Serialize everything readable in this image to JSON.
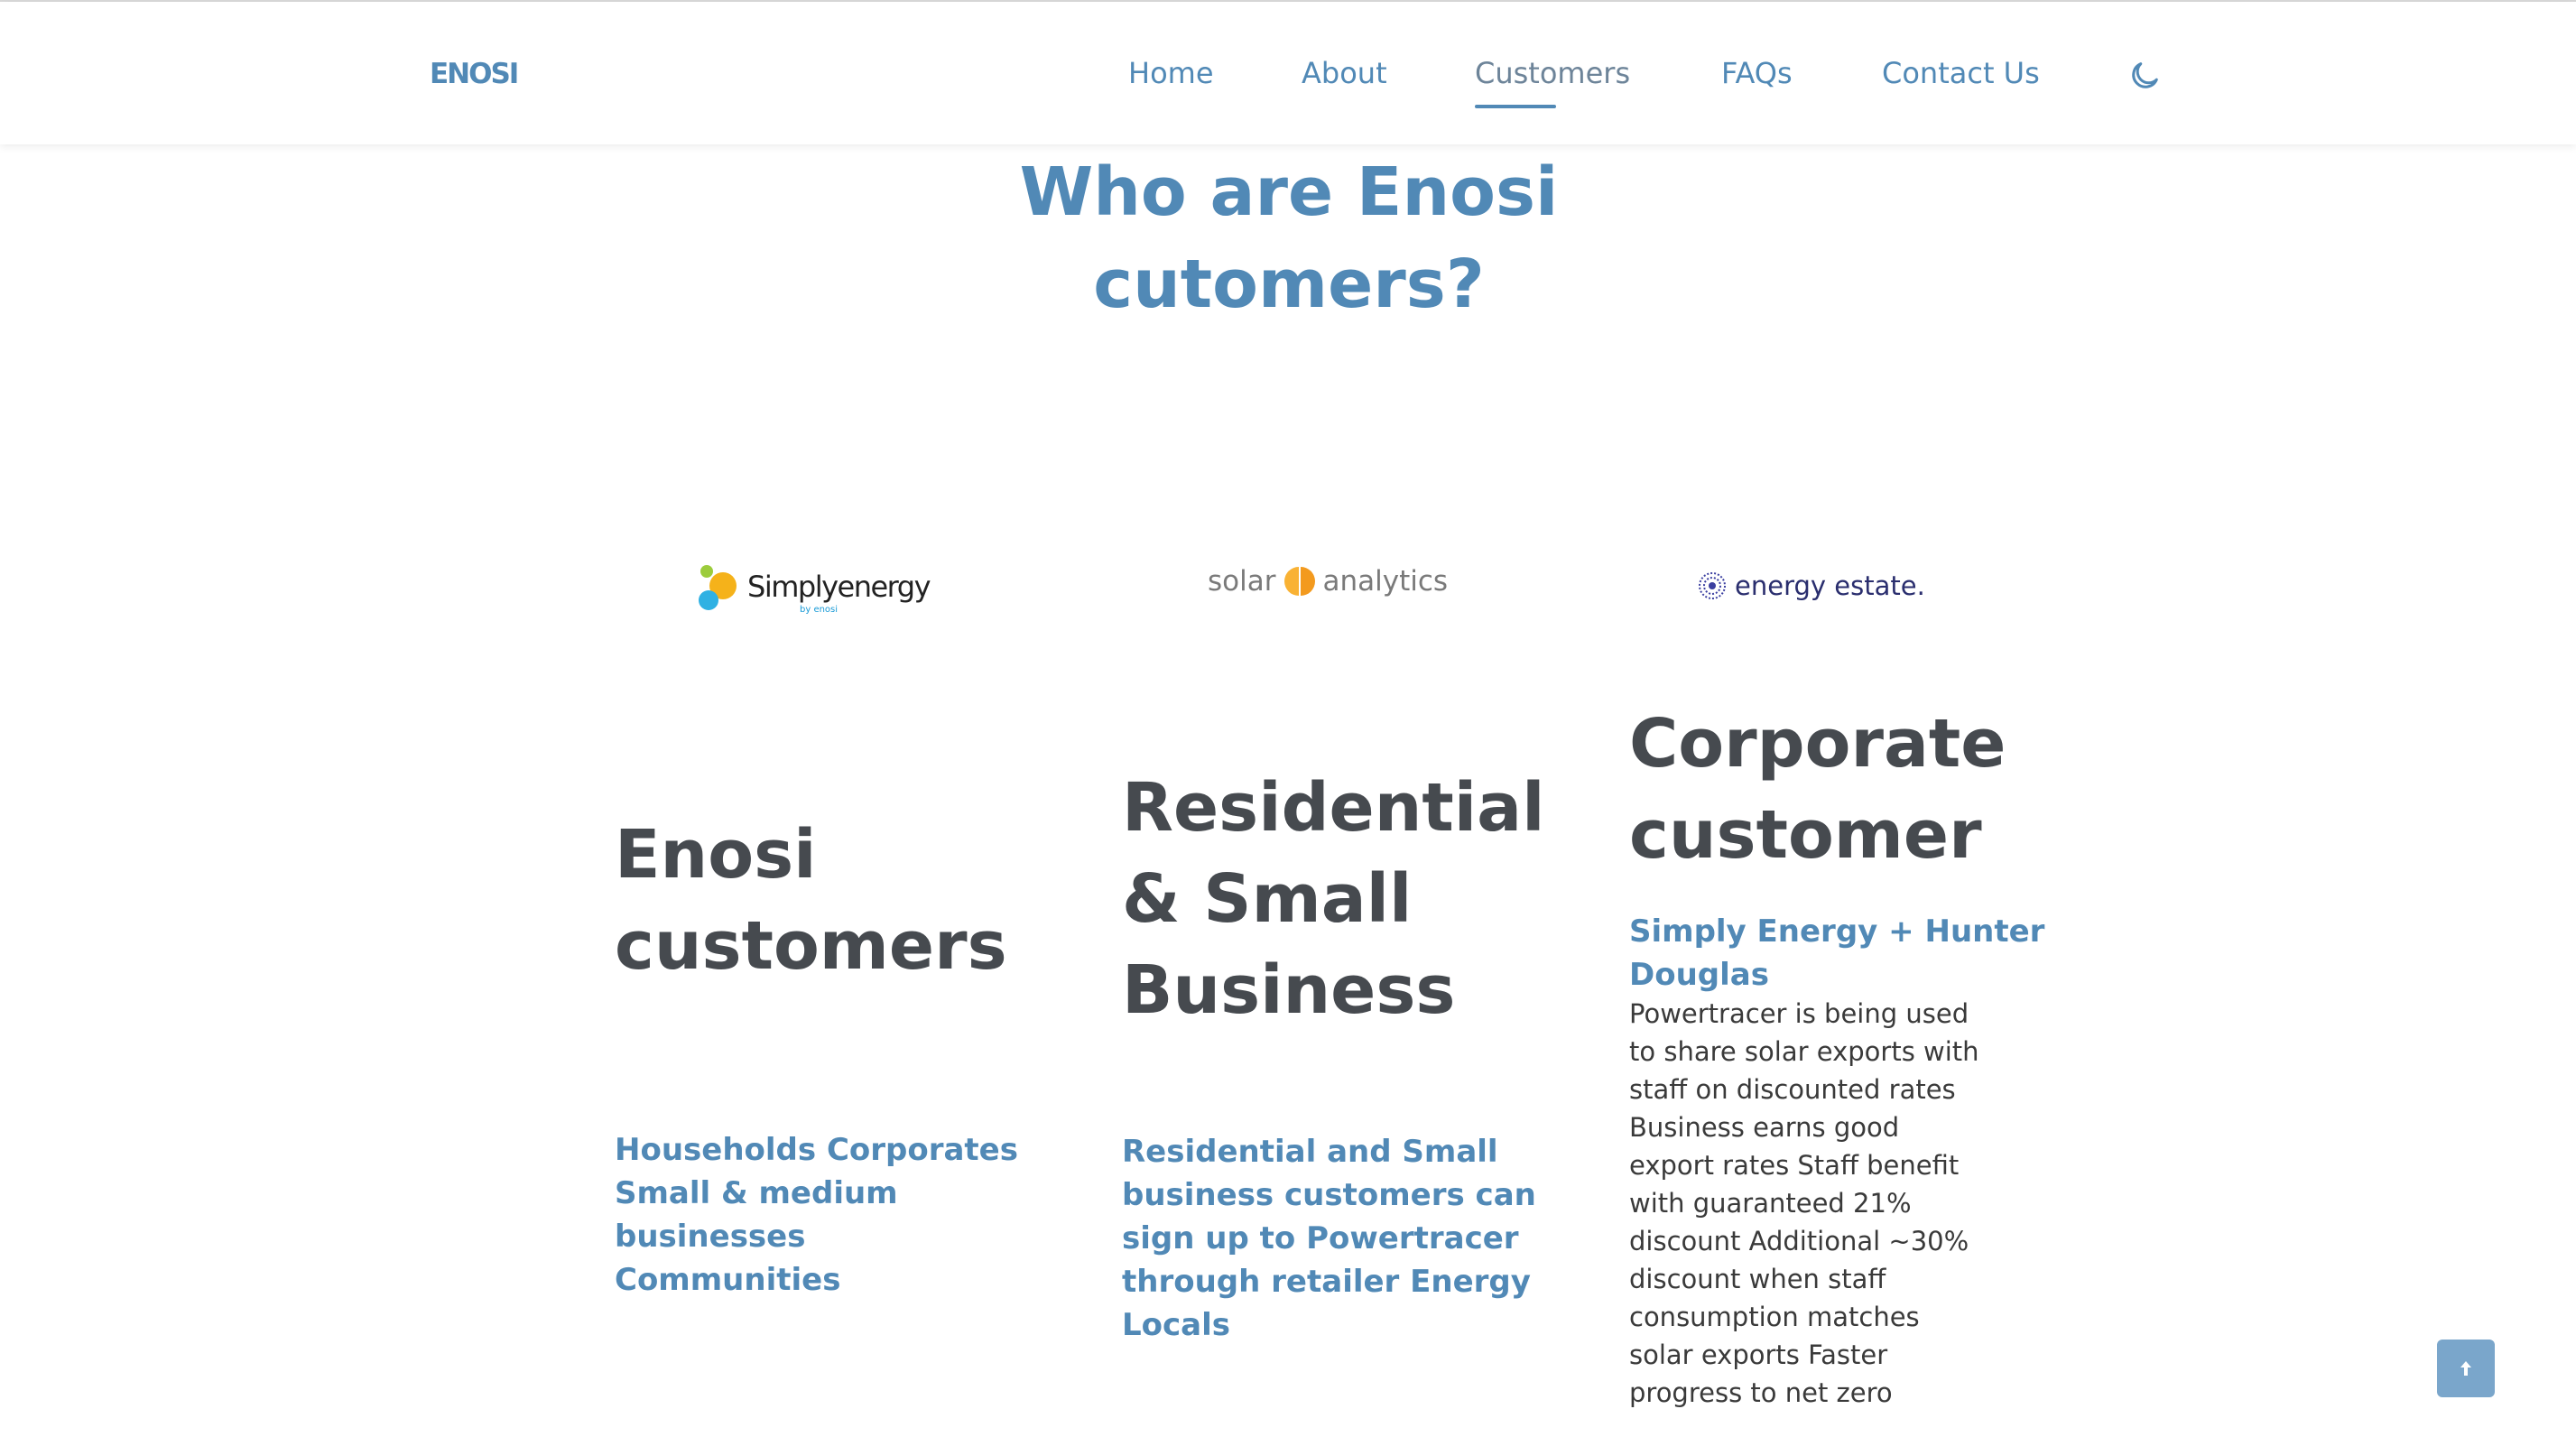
{
  "header": {
    "logo": "ENOSI",
    "nav": [
      {
        "label": "Home",
        "active": false
      },
      {
        "label": "About",
        "active": false
      },
      {
        "label": "Customers",
        "active": true
      },
      {
        "label": "FAQs",
        "active": false
      },
      {
        "label": "Contact Us",
        "active": false
      }
    ],
    "theme_toggle_icon": "moon-icon"
  },
  "main": {
    "title_line1": "Who are Enosi",
    "title_line2": "cutomers?",
    "logos": {
      "simply_energy": {
        "text": "Simply",
        "text2": "energy",
        "sub": "by enosi"
      },
      "solar_analytics": {
        "left": "solar",
        "right": "analytics"
      },
      "energy_estate": {
        "text": "energy estate."
      }
    },
    "columns": [
      {
        "heading_lines": [
          "Enosi",
          "customers"
        ],
        "sub_lines": [
          "Households Corporates",
          "Small & medium",
          "businesses",
          "Communities"
        ]
      },
      {
        "heading_lines": [
          "Residential",
          "& Small",
          "Business"
        ],
        "sub_lines": [
          "Residential and Small",
          "business customers can",
          "sign up to Powertracer",
          "through retailer Energy",
          "Locals"
        ]
      },
      {
        "heading_lines": [
          "Corporate",
          "customer"
        ],
        "sub_lines": [
          "Simply Energy + Hunter",
          "Douglas"
        ],
        "body_lines": [
          "Powertracer is being used",
          "to share solar exports with",
          "staff on discounted rates",
          "Business earns good",
          "export rates Staff benefit",
          "with guaranteed 21%",
          "discount Additional ~30%",
          "discount when staff",
          "consumption matches",
          "solar exports Faster",
          "progress to net zero"
        ]
      }
    ]
  },
  "scroll_to_top_icon": "arrow-up-icon",
  "colors": {
    "accent": "#5189b6",
    "heading": "#464a4f",
    "button": "#7aa6cb"
  }
}
